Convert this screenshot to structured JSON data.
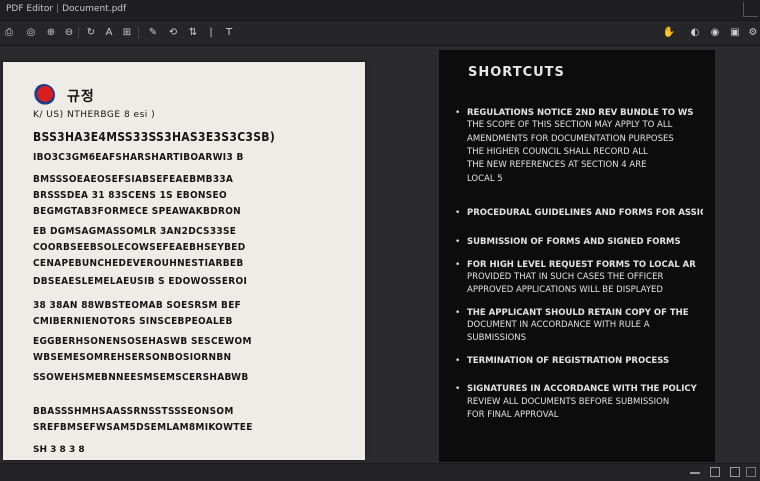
{
  "window": {
    "title_app": "PDF Editor",
    "title_file": "Document.pdf"
  },
  "toolbar": {
    "buttons": [
      {
        "label": "⎙"
      },
      {
        "label": "◎"
      },
      {
        "label": "⊕"
      },
      {
        "label": "⊖"
      },
      {
        "label": "↻"
      },
      {
        "label": "A"
      },
      {
        "label": "⊞"
      },
      {
        "label": "✎"
      },
      {
        "label": "⟲"
      },
      {
        "label": "⇅"
      },
      {
        "label": "|"
      },
      {
        "label": "T"
      }
    ],
    "right_buttons": [
      {
        "label": "✋"
      },
      {
        "label": "◐"
      },
      {
        "label": "◉"
      },
      {
        "label": "▣"
      },
      {
        "label": "⚙"
      }
    ]
  },
  "document": {
    "heading": "규정",
    "subtitle": "K/ US) NTHERBGE 8 esi )",
    "lines": [
      "BSS3HA3E4MSS33SS3HAS3E3S3C3SB)",
      "IBO3C3GM6EAFSHARSHARTIBOARWI3 B",
      "BMSSSOEAEOSEFSIABSEFEAEBMB33A",
      "BRSSSDEA 31 83SCENS 1S EBONSEO",
      "BEGMGTAB3FORMECE SPEAWAKBDRON",
      "EB DGMSAGMASSOMLR 3AN2DCS33SE",
      "COORBSEEBSOLECOWSEFEAEBHSEYBED",
      "CENAPEBUNCHEDEVEROUHNESTIARBEB",
      "DBSEAESLEMELAEUSIB S EDOWOSSEROI",
      "38 38AN 88WBSTEOMAB SOESRSM BEF",
      "CMIBERNIENOTORS SINSCEBPEOALEB",
      "EGGBERHSONENSOSEHASWB SESCEWOM",
      "WBSEMESOMREHSERSONBOSIORNBN",
      "SSOWEHSMEBNNEESMSEMSCERSHABWB",
      "BBASSSHMHSAASSRNSSTSSSEONSOM",
      "SREFBMSEFWSAM5DSEMLAM8MIKOWTEE"
    ],
    "footer": "SH 3 8 3 8"
  },
  "side_panel": {
    "title": "SHORTCUTS",
    "items": [
      {
        "lines": [
          "REGULATIONS NOTICE 2ND REV BUNDLE TO WS",
          "THE SCOPE OF THIS SECTION MAY APPLY TO ALL",
          "AMENDMENTS FOR DOCUMENTATION PURPOSES",
          "THE HIGHER COUNCIL SHALL RECORD ALL",
          "THE NEW REFERENCES AT SECTION 4 ARE",
          "LOCAL 5"
        ]
      },
      {
        "lines": [
          "PROCEDURAL GUIDELINES AND FORMS FOR ASSIGN"
        ]
      },
      {
        "lines": [
          "SUBMISSION OF FORMS AND SIGNED FORMS"
        ]
      },
      {
        "lines": [
          "FOR HIGH LEVEL REQUEST FORMS TO LOCAL AR",
          "PROVIDED THAT IN SUCH CASES THE OFFICER",
          "APPROVED APPLICATIONS WILL BE DISPLAYED"
        ]
      },
      {
        "lines": [
          "THE APPLICANT SHOULD RETAIN COPY OF THE",
          "DOCUMENT IN ACCORDANCE WITH RULE A",
          "SUBMISSIONS"
        ]
      },
      {
        "lines": [
          "TERMINATION OF REGISTRATION PROCESS"
        ]
      },
      {
        "lines": [
          "SIGNATURES IN ACCORDANCE WITH THE POLICY",
          "REVIEW ALL DOCUMENTS BEFORE SUBMISSION",
          "FOR FINAL APPROVAL"
        ]
      }
    ]
  },
  "colors": {
    "accent": "#d81e1e",
    "page_bg": "#eeece7",
    "panel_bg": "#0c0c0c",
    "chrome_bg": "#2b2b2e"
  }
}
